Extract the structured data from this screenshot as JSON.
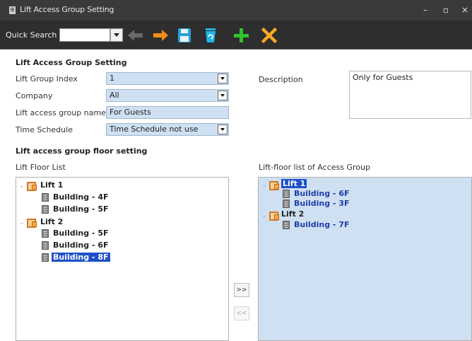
{
  "window": {
    "title": "Lift Access Group Setting",
    "controls": {
      "minimize": "–",
      "maximize": "▫",
      "close": "×"
    }
  },
  "toolbar": {
    "quick_search_label": "Quick Search",
    "quick_search_value": "",
    "icons": [
      "back-arrow-icon",
      "forward-arrow-icon",
      "save-icon",
      "delete-icon",
      "add-icon",
      "cancel-icon"
    ],
    "colors": {
      "back": "#6a6a6a",
      "forward": "#f28c1a",
      "save": "#2aa0d8",
      "delete": "#21b6e6",
      "add": "#2ec42c",
      "cancel": "#f7a823"
    }
  },
  "settings": {
    "section_title": "Lift Access Group Setting",
    "lift_group_index": {
      "label": "Lift Group Index",
      "value": "1"
    },
    "company": {
      "label": "Company",
      "value": "All"
    },
    "group_name": {
      "label": "Lift access group name",
      "value": "For Guests"
    },
    "time_schedule": {
      "label": "Time Schedule",
      "value": "Time Schedule not use"
    },
    "description": {
      "label": "Description",
      "value": "Only for Guests"
    }
  },
  "floor_setting": {
    "section_title": "Lift access group floor setting",
    "left_title": "Lift  Floor List",
    "right_title": "Lift-floor list of Access Group",
    "left_tree": [
      {
        "label": "Lift 1",
        "children": [
          "Building - 4F",
          "Building - 5F"
        ]
      },
      {
        "label": "Lift 2",
        "children": [
          "Building - 5F",
          "Building - 6F",
          "Building - 8F"
        ]
      }
    ],
    "right_tree": [
      {
        "label": "Lift 1",
        "children": [
          "Building - 6F",
          "Building - 3F"
        ]
      },
      {
        "label": "Lift 2",
        "children": [
          "Building - 7F"
        ]
      }
    ],
    "add_button": ">>",
    "remove_button": "<<"
  }
}
